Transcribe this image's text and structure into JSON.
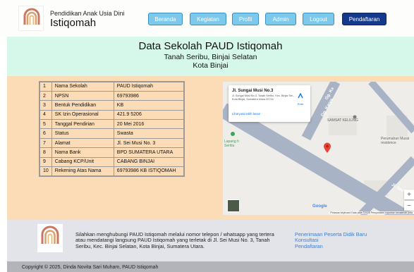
{
  "header": {
    "subtitle": "Pendidikan Anak Usia Dini",
    "title": "Istiqomah",
    "logo_text": "PAUD ISTIQOMAH",
    "nav": [
      {
        "label": "Beranda"
      },
      {
        "label": "Kegiatan"
      },
      {
        "label": "Profil"
      },
      {
        "label": "Admin"
      },
      {
        "label": "Logout"
      },
      {
        "label": "Pendaftaran"
      }
    ]
  },
  "banner": {
    "title": "Data Sekolah PAUD Istiqomah",
    "line1": "Tanah Seribu, Binjai Selatan",
    "line2": "Kota Binjai"
  },
  "school_table": {
    "rows": [
      {
        "no": "1",
        "field": "Nama Sekolah",
        "value": "PAUD Istiqomah"
      },
      {
        "no": "2",
        "field": "NPSN",
        "value": "69793986"
      },
      {
        "no": "3",
        "field": "Bentuk Pendidikan",
        "value": "KB"
      },
      {
        "no": "4",
        "field": "SK Izin Operasional",
        "value": "421.9 5206"
      },
      {
        "no": "5",
        "field": "Tanggal Pendirian",
        "value": "20 Mei 2016"
      },
      {
        "no": "6",
        "field": "Status",
        "value": "Swasta"
      },
      {
        "no": "7",
        "field": "Alamat",
        "value": "Jl. Sei Musi No. 3"
      },
      {
        "no": "8",
        "field": "Nama Bank",
        "value": "BPD SUMATERA UTARA"
      },
      {
        "no": "9",
        "field": "Cabang KCP/Unit",
        "value": "CABANG BINJAI"
      },
      {
        "no": "10",
        "field": "Rekening Atas Nama",
        "value": "69793986 KB ISTIQOMAH"
      }
    ]
  },
  "map": {
    "card_title": "Jl. Sungai Musi No.3",
    "card_address": "Jl. Sungai Musi No.3, Tanah Seribu, Kec. Binjai Sel., Kota Binjai, Sumatera Utara 20734",
    "route_label": "Rute",
    "larger_map_link": "Lihat peta lebih besar",
    "label_samsat": "SAMSAT KELILING",
    "label_perumahan": "Perumahan Mussi residence",
    "label_lapang": "Lapang h Seribu",
    "street_1": "Gg. Karya",
    "street_2": "Gg. Ke",
    "street_3": "Jl. Ssu",
    "zoom_in": "+",
    "zoom_out": "−",
    "google": "Google",
    "footer_shortcuts": "Pintasan keyboard",
    "footer_data": "Data peta ©2025",
    "footer_terms": "Persyaratan",
    "footer_report": "Laporkan kesalahan peta"
  },
  "footer": {
    "text": "Silahkan menghubungi PAUD Istiqomah melalui nomor telepon / whatsapp yang tertera atau mendatangi langsung PAUD Istiqomah yang terletak di Jl. Sei Musi No. 3, Tanah Seribu, Kec. Binjai Selatan, Kota Binjai, Sumatera Utara.",
    "links": [
      {
        "label": "Penerimaan Peserta Didik Baru"
      },
      {
        "label": "Konsultasi"
      },
      {
        "label": "Pendaftaran"
      }
    ]
  },
  "copyright": "Copyright © 2025, Dinda Novita Sari Muham, PAUD Istiqomah",
  "colors": {
    "banner_bg": "#d6f8ea",
    "main_bg": "#fcdcb6",
    "nav_button": "#7cc9ec",
    "nav_primary": "#14388a",
    "footer_bg": "#e3e4ea",
    "copyright_bg": "#b3b4ba"
  }
}
